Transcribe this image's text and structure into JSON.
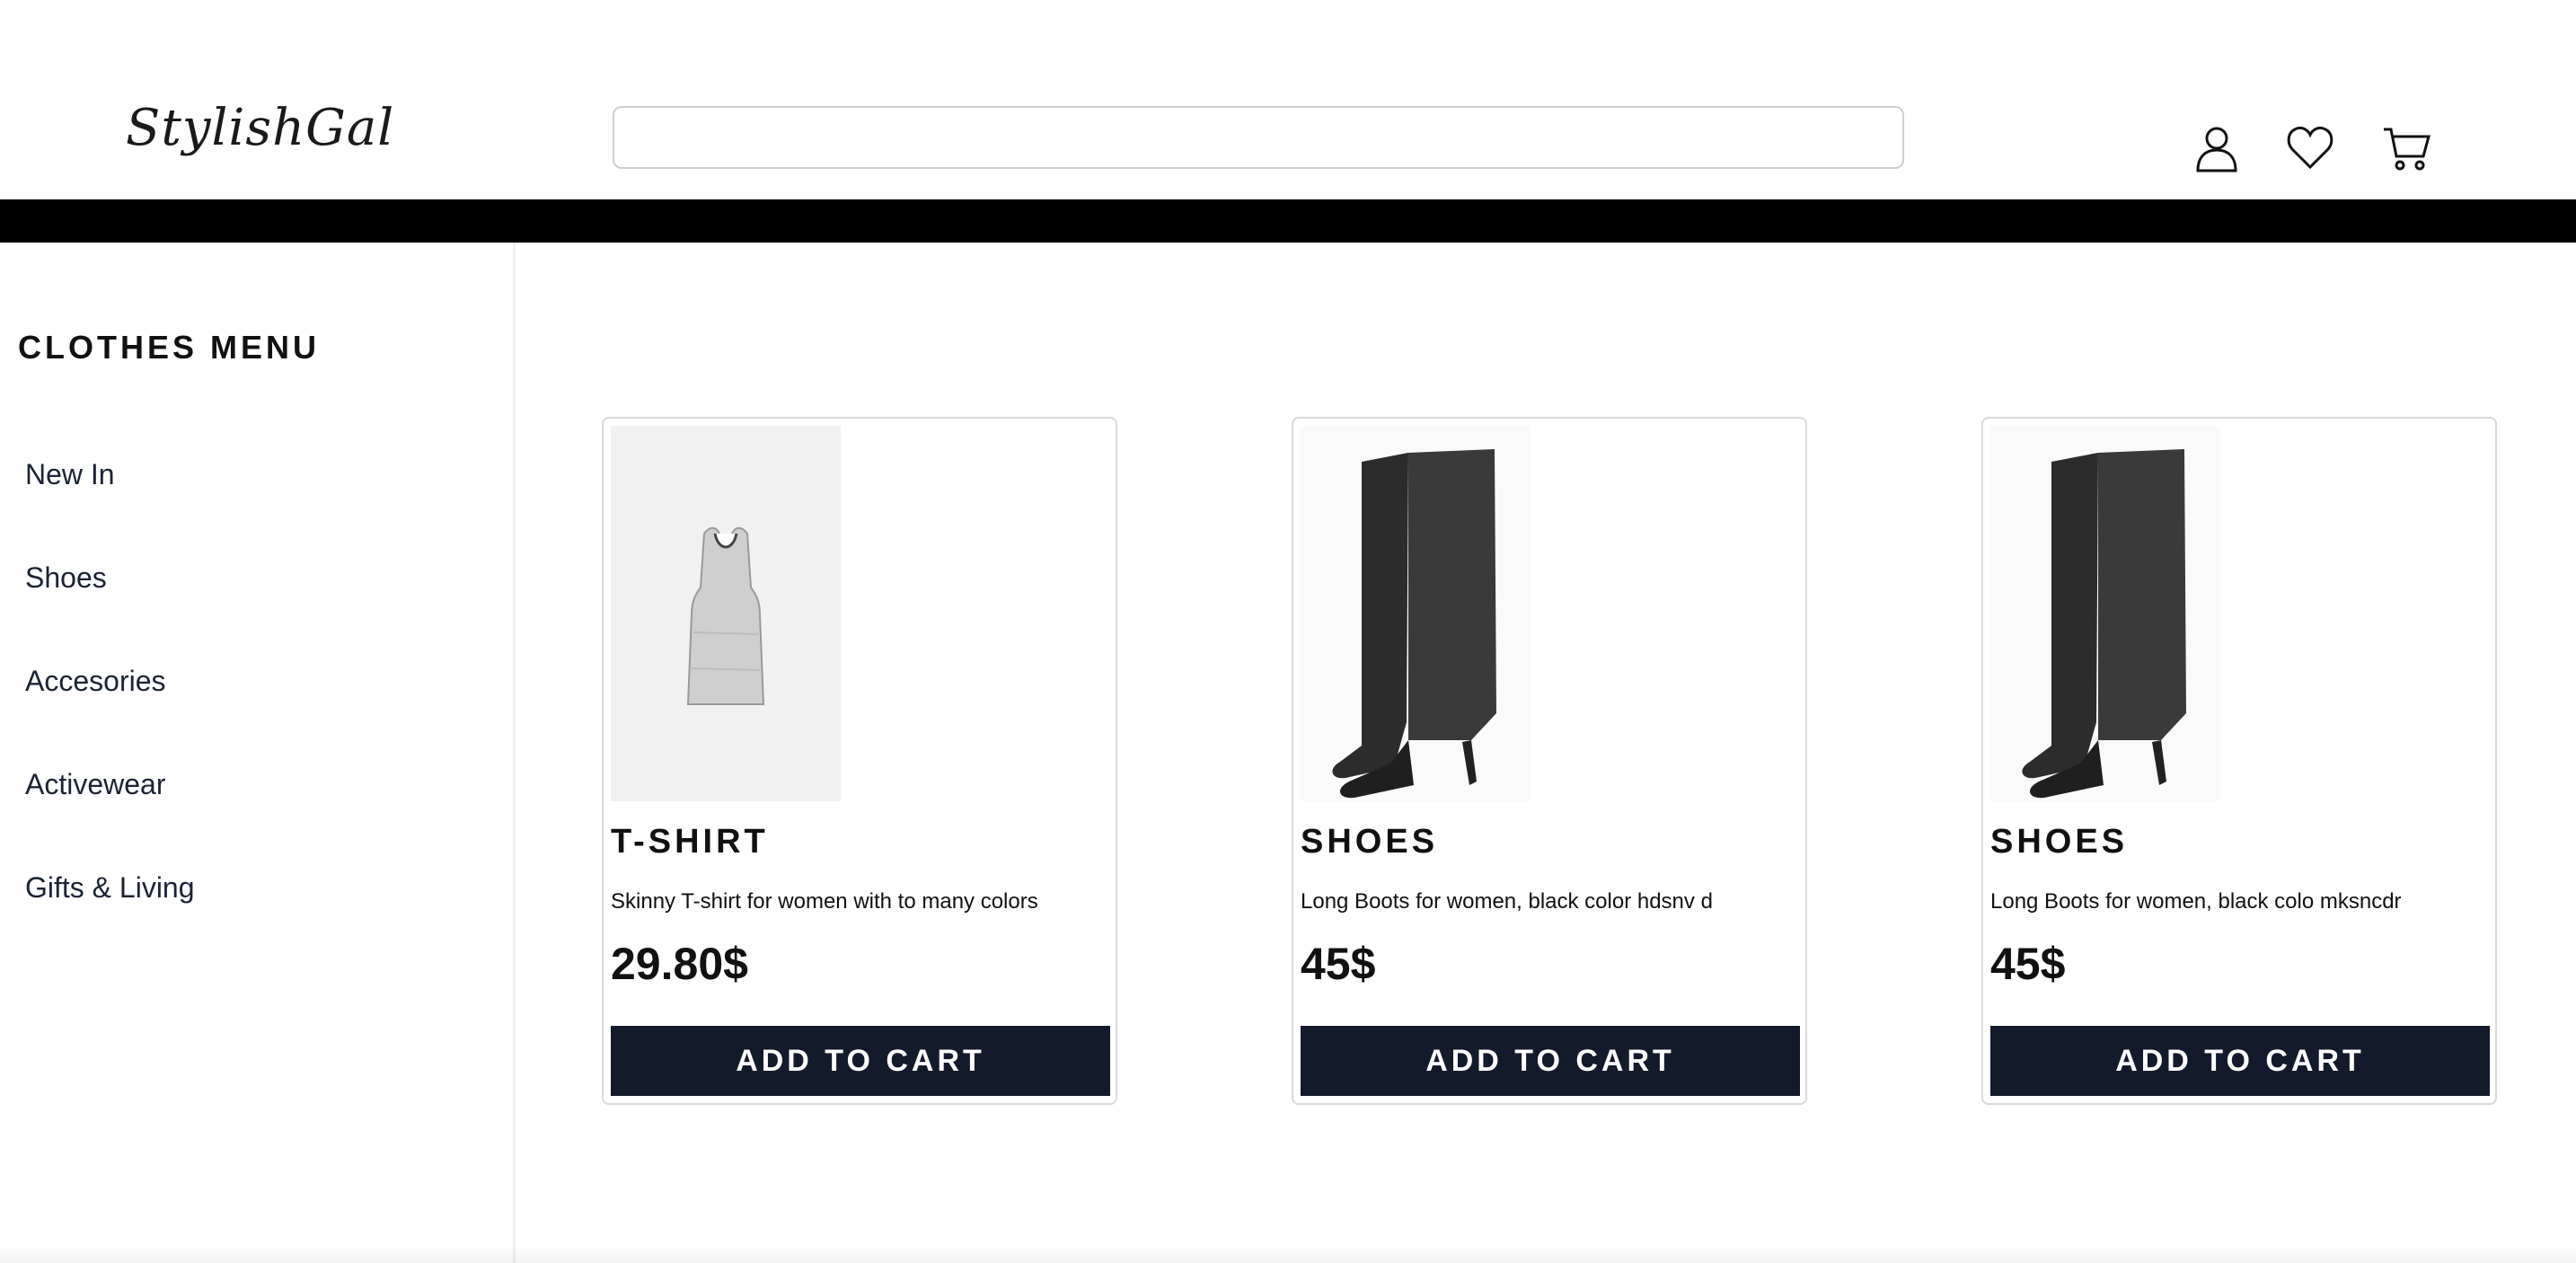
{
  "header": {
    "logo_text": "StylishGal",
    "search": {
      "value": "",
      "placeholder": ""
    },
    "icons": [
      "user-icon",
      "heart-icon",
      "cart-icon"
    ]
  },
  "sidebar": {
    "title": "CLOTHES MENU",
    "items": [
      {
        "label": "New In"
      },
      {
        "label": "Shoes"
      },
      {
        "label": "Accesories"
      },
      {
        "label": "Activewear"
      },
      {
        "label": "Gifts & Living"
      }
    ]
  },
  "products": [
    {
      "category": "T-SHIRT",
      "description": "Skinny T-shirt for women with to many colors",
      "price": "29.80$",
      "button_label": "ADD TO CART",
      "image": "tank-top-image"
    },
    {
      "category": "SHOES",
      "description": "Long Boots for women, black color hdsnv d",
      "price": "45$",
      "button_label": "ADD TO CART",
      "image": "boots-image"
    },
    {
      "category": "SHOES",
      "description": "Long Boots for women, black colo mksncdr",
      "price": "45$",
      "button_label": "ADD TO CART",
      "image": "boots-image"
    }
  ],
  "colors": {
    "band": "#000000",
    "button_bg": "#131a2b",
    "button_text": "#ffffff"
  }
}
